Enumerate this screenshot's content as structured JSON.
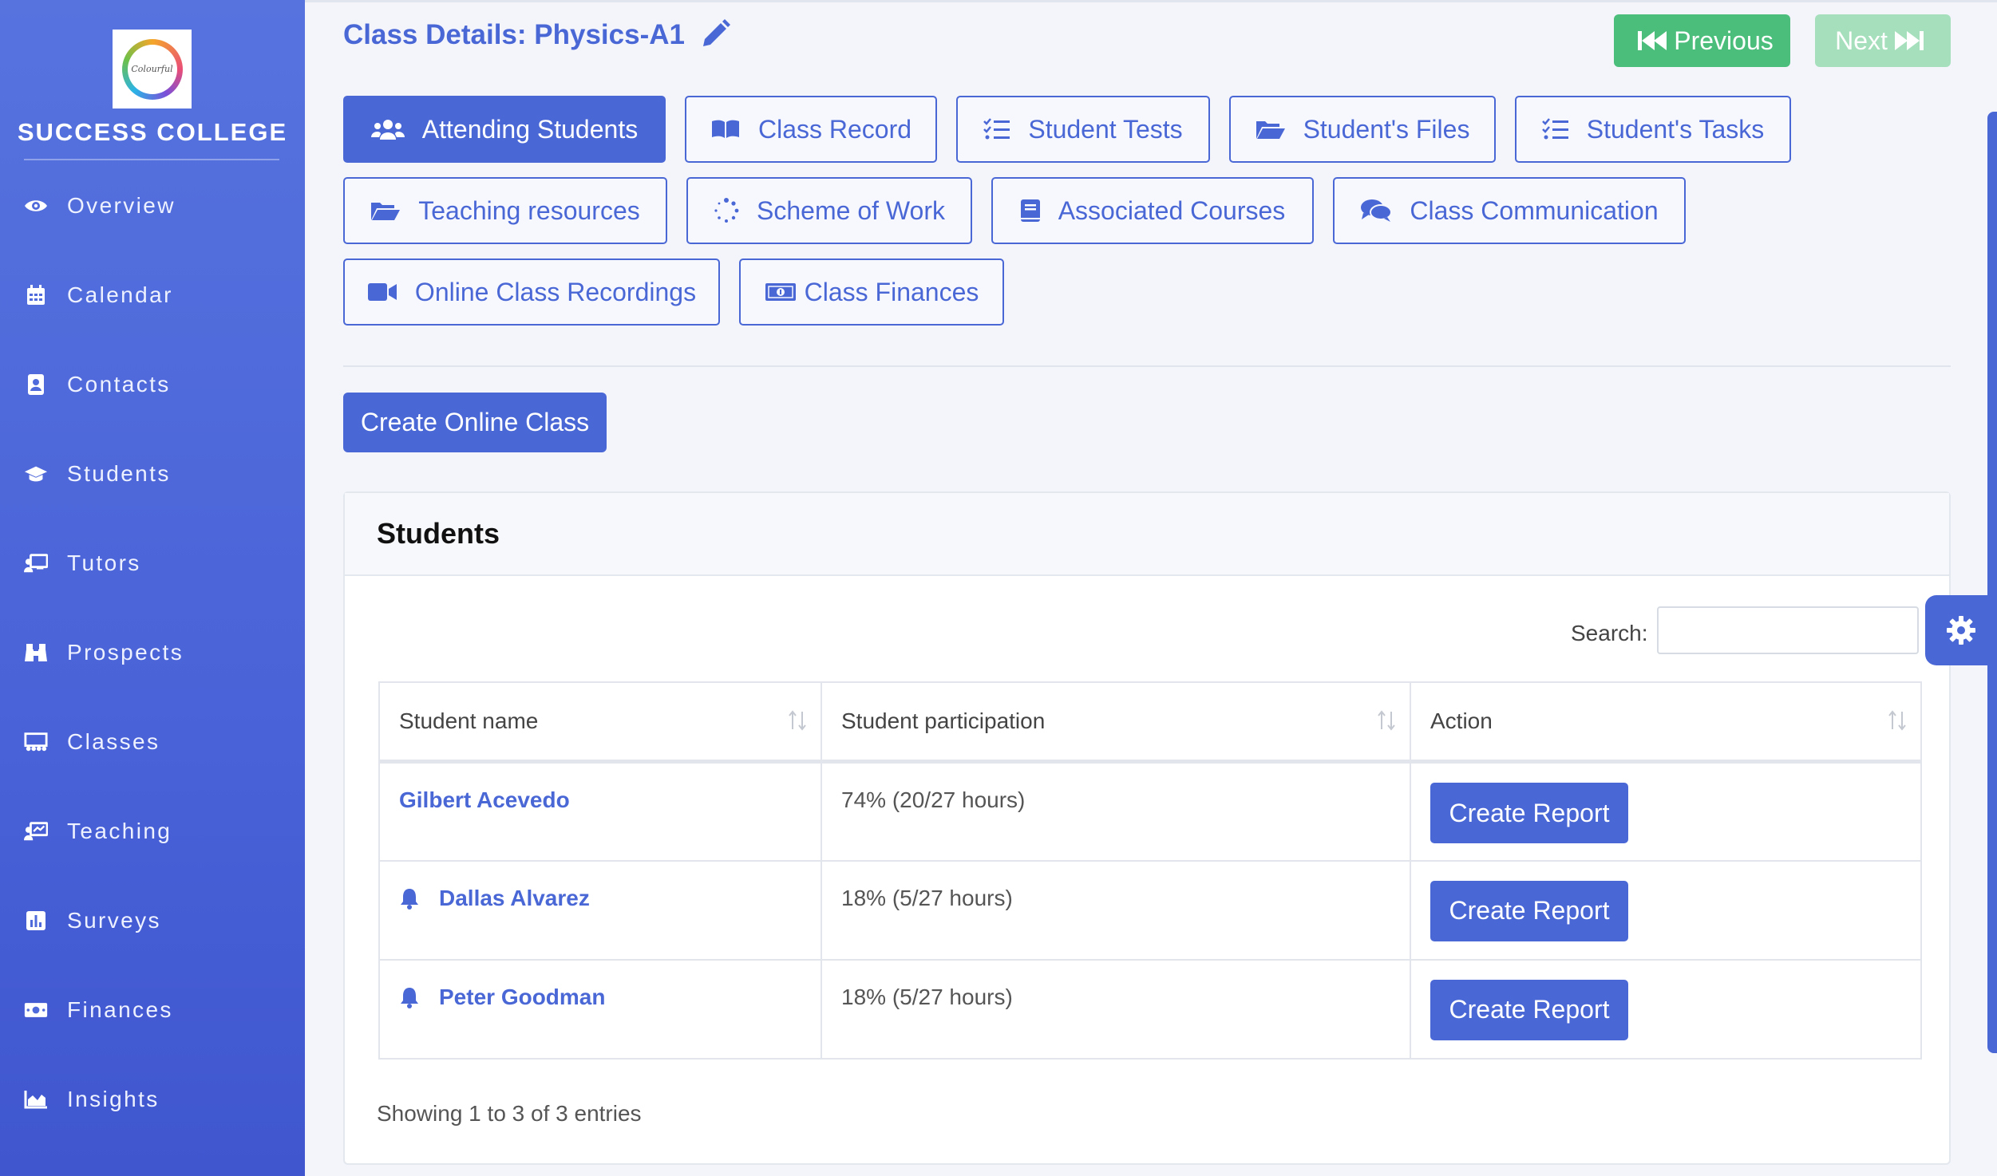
{
  "sidebar": {
    "college_name": "SUCCESS COLLEGE",
    "logo_text": "Colourful",
    "items": [
      {
        "label": "Overview",
        "icon": "eye-icon"
      },
      {
        "label": "Calendar",
        "icon": "calendar-icon"
      },
      {
        "label": "Contacts",
        "icon": "address-book-icon"
      },
      {
        "label": "Students",
        "icon": "graduation-cap-icon"
      },
      {
        "label": "Tutors",
        "icon": "chalkboard-teacher-icon"
      },
      {
        "label": "Prospects",
        "icon": "binoculars-icon"
      },
      {
        "label": "Classes",
        "icon": "classroom-icon"
      },
      {
        "label": "Teaching",
        "icon": "teaching-board-icon"
      },
      {
        "label": "Surveys",
        "icon": "poll-icon"
      },
      {
        "label": "Finances",
        "icon": "money-bill-icon"
      },
      {
        "label": "Insights",
        "icon": "area-chart-icon"
      }
    ]
  },
  "header": {
    "title": "Class Details: Physics-A1",
    "previous_label": "Previous",
    "next_label": "Next"
  },
  "tabs": [
    {
      "label": "Attending Students",
      "icon": "users-icon",
      "active": true
    },
    {
      "label": "Class Record",
      "icon": "book-open-icon"
    },
    {
      "label": "Student Tests",
      "icon": "tasks-list-icon"
    },
    {
      "label": "Student's Files",
      "icon": "folder-open-icon"
    },
    {
      "label": "Student's Tasks",
      "icon": "tasks-list-icon"
    },
    {
      "label": "Teaching resources",
      "icon": "folder-open-icon"
    },
    {
      "label": "Scheme of Work",
      "icon": "spinner-icon"
    },
    {
      "label": "Associated Courses",
      "icon": "book-icon"
    },
    {
      "label": "Class Communication",
      "icon": "comments-icon"
    },
    {
      "label": "Online Class Recordings",
      "icon": "video-icon"
    },
    {
      "label": "Class Finances",
      "icon": "money-bill-icon"
    }
  ],
  "create_online_label": "Create Online Class",
  "students_card": {
    "title": "Students",
    "search_label": "Search:",
    "search_value": "",
    "columns": [
      "Student name",
      "Student participation",
      "Action"
    ],
    "rows": [
      {
        "name": "Gilbert Acevedo",
        "participation": "74% (20/27 hours)",
        "alert": false,
        "action": "Create Report"
      },
      {
        "name": "Dallas Alvarez",
        "participation": "18% (5/27 hours)",
        "alert": true,
        "action": "Create Report"
      },
      {
        "name": "Peter Goodman",
        "participation": "18% (5/27 hours)",
        "alert": true,
        "action": "Create Report"
      }
    ],
    "entries_text": "Showing 1 to 3 of 3 entries"
  },
  "colors": {
    "primary": "#4a67d6",
    "sidebar": "#4a63d8",
    "prev_green": "#4cbe7c",
    "next_green_disabled": "#a6dfbc"
  }
}
